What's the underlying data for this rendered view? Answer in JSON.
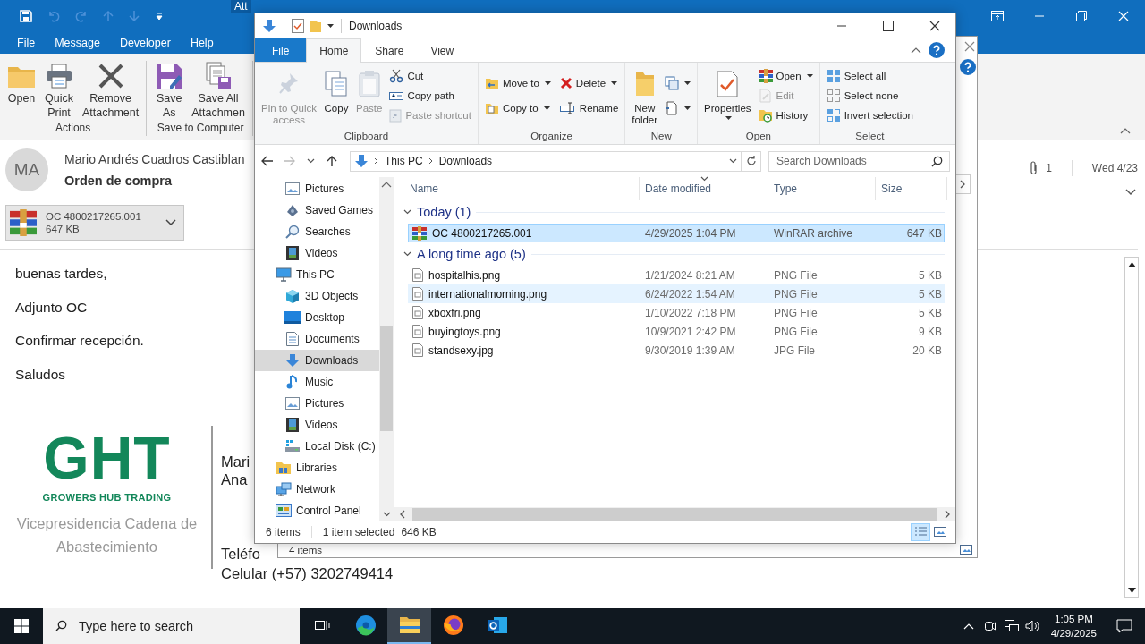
{
  "outlook": {
    "title_bar": {
      "context_tab": "Att"
    },
    "menu_tabs": [
      {
        "label": "File",
        "selected": false
      },
      {
        "label": "Message",
        "selected": false
      },
      {
        "label": "Developer",
        "selected": false
      },
      {
        "label": "Help",
        "selected": false
      }
    ],
    "ribbon_groups": [
      {
        "label": "Actions",
        "buttons": [
          {
            "lines": [
              "Open"
            ]
          },
          {
            "lines": [
              "Quick",
              "Print"
            ]
          },
          {
            "lines": [
              "Remove",
              "Attachment"
            ]
          }
        ]
      },
      {
        "label": "Save to Computer",
        "buttons": [
          {
            "lines": [
              "Save",
              "As"
            ]
          },
          {
            "lines": [
              "Save All",
              "Attachmen"
            ]
          }
        ]
      }
    ],
    "message": {
      "avatar": "MA",
      "sender": "Mario Andrés Cuadros Castiblan",
      "subject": "Orden de compra",
      "attachment_count": "1",
      "date": "Wed 4/23",
      "attachment": {
        "name": "OC 4800217265.001",
        "size": "647 KB"
      },
      "body": [
        "buenas tardes,",
        "Adjunto OC",
        "Confirmar recepción.",
        "Saludos"
      ],
      "signature": {
        "logo": "GHT",
        "tagline": "GROWERS HUB TRADING",
        "department": "Vicepresidencia Cadena de Abastecimiento",
        "lines": [
          "Mari",
          "Ana",
          "Teléfo",
          "Celular (+57) 3202749414"
        ]
      }
    }
  },
  "back_window": {
    "status": "4 items"
  },
  "explorer": {
    "title": "Downloads",
    "tabs": [
      {
        "label": "File",
        "kind": "file",
        "selected": false
      },
      {
        "label": "Home",
        "kind": "tab",
        "selected": true
      },
      {
        "label": "Share",
        "kind": "tab",
        "selected": false
      },
      {
        "label": "View",
        "kind": "tab",
        "selected": false
      }
    ],
    "ribbon": [
      {
        "label": "Clipboard",
        "kind": "stack",
        "buttons": [
          {
            "kind": "large",
            "lines": [
              "Pin to Quick",
              "access"
            ],
            "disabled": true,
            "dropdown": false
          },
          {
            "kind": "large",
            "lines": [
              "Copy"
            ],
            "disabled": false,
            "dropdown": false
          },
          {
            "kind": "large",
            "lines": [
              "Paste"
            ],
            "disabled": true,
            "dropdown": false
          },
          {
            "kind": "small",
            "label": "Cut",
            "disabled": false,
            "dropdown": false
          },
          {
            "kind": "small",
            "label": "Copy path",
            "disabled": false,
            "dropdown": false
          },
          {
            "kind": "small",
            "label": "Paste shortcut",
            "disabled": true,
            "dropdown": false
          }
        ]
      },
      {
        "label": "Organize",
        "kind": "pairs",
        "buttons": [
          {
            "kind": "small",
            "label": "Move to",
            "disabled": false,
            "dropdown": true
          },
          {
            "kind": "small",
            "label": "Copy to",
            "disabled": false,
            "dropdown": true
          },
          {
            "kind": "small",
            "label": "Delete",
            "disabled": false,
            "dropdown": true
          },
          {
            "kind": "small",
            "label": "Rename",
            "disabled": false,
            "dropdown": false
          }
        ]
      },
      {
        "label": "New",
        "kind": "pairs",
        "buttons": [
          {
            "kind": "large",
            "lines": [
              "New",
              "folder"
            ],
            "disabled": false,
            "dropdown": false
          },
          {
            "kind": "small",
            "disabled": false,
            "dropdown": true
          },
          {
            "kind": "small",
            "disabled": false,
            "dropdown": true
          }
        ]
      },
      {
        "label": "Open",
        "kind": "stack",
        "buttons": [
          {
            "kind": "large",
            "lines": [
              "Properties"
            ],
            "disabled": false,
            "dropdown": true
          },
          {
            "kind": "small",
            "label": "Open",
            "disabled": false,
            "dropdown": true
          },
          {
            "kind": "small",
            "label": "Edit",
            "disabled": true,
            "dropdown": false
          },
          {
            "kind": "small",
            "label": "History",
            "disabled": false,
            "dropdown": false
          }
        ]
      },
      {
        "label": "Select",
        "kind": "stack",
        "buttons": [
          {
            "kind": "small",
            "label": "Select all",
            "disabled": false,
            "dropdown": false
          },
          {
            "kind": "small",
            "label": "Select none",
            "disabled": false,
            "dropdown": false
          },
          {
            "kind": "small",
            "label": "Invert selection",
            "disabled": false,
            "dropdown": false
          }
        ]
      }
    ],
    "address": {
      "path": [
        "This PC",
        "Downloads"
      ],
      "search_placeholder": "Search Downloads"
    },
    "nav": [
      {
        "children": [
          {
            "label": "Pictures",
            "selected": false
          },
          {
            "label": "Saved Games",
            "selected": false
          },
          {
            "label": "Searches",
            "selected": false
          },
          {
            "label": "Videos",
            "selected": false
          }
        ]
      },
      {
        "label": "This PC",
        "selected": false,
        "children": [
          {
            "label": "3D Objects",
            "selected": false
          },
          {
            "label": "Desktop",
            "selected": false
          },
          {
            "label": "Documents",
            "selected": false
          },
          {
            "label": "Downloads",
            "selected": true
          },
          {
            "label": "Music",
            "selected": false
          },
          {
            "label": "Pictures",
            "selected": false
          },
          {
            "label": "Videos",
            "selected": false
          },
          {
            "label": "Local Disk (C:)",
            "selected": false
          }
        ]
      },
      {
        "label": "Libraries",
        "selected": false
      },
      {
        "label": "Network",
        "selected": false
      },
      {
        "label": "Control Panel",
        "selected": false
      }
    ],
    "columns": [
      {
        "label": "Name",
        "sorted": false
      },
      {
        "label": "Date modified",
        "sorted": true
      },
      {
        "label": "Type",
        "sorted": false
      },
      {
        "label": "Size",
        "sorted": false
      }
    ],
    "groups": [
      {
        "label": "Today (1)",
        "expanded": true,
        "rows": [
          {
            "name": "OC 4800217265.001",
            "date": "4/29/2025 1:04 PM",
            "type": "WinRAR archive",
            "size": "647 KB",
            "selected": true,
            "hovered": false
          }
        ]
      },
      {
        "label": "A long time ago (5)",
        "expanded": true,
        "rows": [
          {
            "name": "hospitalhis.png",
            "date": "1/21/2024 8:21 AM",
            "type": "PNG File",
            "size": "5 KB",
            "selected": false,
            "hovered": false
          },
          {
            "name": "internationalmorning.png",
            "date": "6/24/2022 1:54 AM",
            "type": "PNG File",
            "size": "5 KB",
            "selected": false,
            "hovered": true
          },
          {
            "name": "xboxfri.png",
            "date": "1/10/2022 7:18 PM",
            "type": "PNG File",
            "size": "5 KB",
            "selected": false,
            "hovered": false
          },
          {
            "name": "buyingtoys.png",
            "date": "10/9/2021 2:42 PM",
            "type": "PNG File",
            "size": "9 KB",
            "selected": false,
            "hovered": false
          },
          {
            "name": "standsexy.jpg",
            "date": "9/30/2019 1:39 AM",
            "type": "JPG File",
            "size": "20 KB",
            "selected": false,
            "hovered": false
          }
        ]
      }
    ],
    "status": {
      "count": "6 items",
      "selection": "1 item selected",
      "selection_size": "646 KB"
    },
    "views": [
      {
        "selected": true
      },
      {
        "selected": false
      }
    ]
  },
  "taskbar": {
    "search_placeholder": "Type here to search",
    "apps": [
      {
        "selected": false
      },
      {
        "selected": false
      },
      {
        "selected": true
      },
      {
        "selected": false
      },
      {
        "selected": false
      }
    ],
    "time": "1:05 PM",
    "date": "4/29/2025"
  }
}
